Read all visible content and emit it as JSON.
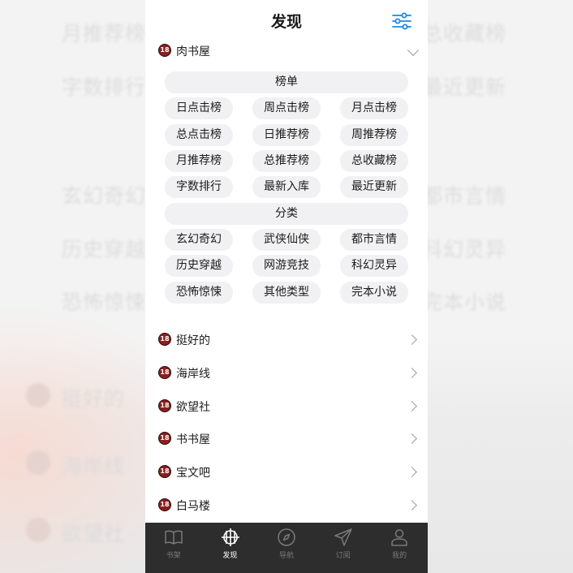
{
  "header": {
    "title": "发现"
  },
  "top_source": {
    "label": "肉书屋",
    "badge": "18"
  },
  "ranking": {
    "title": "榜单",
    "items": [
      "日点击榜",
      "周点击榜",
      "月点击榜",
      "总点击榜",
      "日推荐榜",
      "周推荐榜",
      "月推荐榜",
      "总推荐榜",
      "总收藏榜",
      "字数排行",
      "最新入库",
      "最近更新"
    ]
  },
  "categories": {
    "title": "分类",
    "items": [
      "玄幻奇幻",
      "武侠仙侠",
      "都市言情",
      "历史穿越",
      "网游竞技",
      "科幻灵异",
      "恐怖惊悚",
      "其他类型",
      "完本小说"
    ]
  },
  "sources": [
    {
      "label": "挺好的",
      "badge": "18"
    },
    {
      "label": "海岸线",
      "badge": "18"
    },
    {
      "label": "欲望社",
      "badge": "18"
    },
    {
      "label": "书书屋",
      "badge": "18"
    },
    {
      "label": "宝文吧",
      "badge": "18"
    },
    {
      "label": "白马楼",
      "badge": "18"
    }
  ],
  "background_echo": {
    "row1": [
      "月推荐榜",
      "总收藏榜"
    ],
    "row2": [
      "字数排行",
      "最近更新"
    ],
    "row3": [
      "玄幻奇幻",
      "都市言情"
    ],
    "row4": [
      "历史穿越",
      "科幻灵异"
    ],
    "row5": [
      "恐怖惊悚",
      "完本小说"
    ],
    "sources": [
      "挺好的",
      "海岸线",
      "欲望社"
    ]
  },
  "tabbar": {
    "active": "发现",
    "tabs": [
      {
        "label": "书架",
        "icon": "book-icon"
      },
      {
        "label": "发现",
        "icon": "grid-circle-icon"
      },
      {
        "label": "导航",
        "icon": "compass-icon"
      },
      {
        "label": "订阅",
        "icon": "send-icon"
      },
      {
        "label": "我的",
        "icon": "person-icon"
      }
    ]
  },
  "colors": {
    "accent": "#1e88e5",
    "tabbar_bg": "#2d2d2d",
    "chip_bg": "#f1f1f3",
    "badge": "#8b1f1f"
  }
}
